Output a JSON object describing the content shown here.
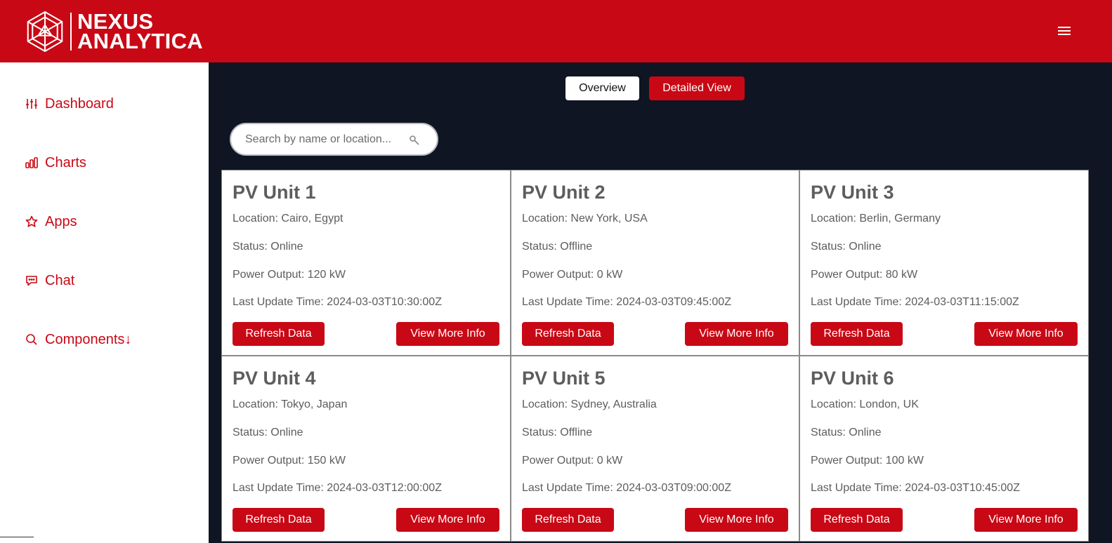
{
  "brand": {
    "line1": "NEXUS",
    "line2": "ANALYTICA",
    "color": "#c90815"
  },
  "header": {
    "menu_icon": "hamburger-menu-icon"
  },
  "sidebar": {
    "items": [
      {
        "label": "Dashboard",
        "icon": "sliders-icon"
      },
      {
        "label": "Charts",
        "icon": "bar-chart-icon"
      },
      {
        "label": "Apps",
        "icon": "star-icon"
      },
      {
        "label": "Chat",
        "icon": "chat-bubble-icon"
      },
      {
        "label": "Components↓",
        "icon": "search-icon"
      }
    ]
  },
  "tabs": {
    "overview": "Overview",
    "detailed": "Detailed View"
  },
  "search": {
    "placeholder": "Search by name or location..."
  },
  "units": [
    {
      "name": "PV Unit 1",
      "location": "Location: Cairo, Egypt",
      "status": "Status: Online",
      "power": "Power Output: 120 kW",
      "updated": "Last Update Time: 2024-03-03T10:30:00Z",
      "refresh": "Refresh Data",
      "more": "View More Info"
    },
    {
      "name": "PV Unit 2",
      "location": "Location: New York, USA",
      "status": "Status: Offline",
      "power": "Power Output: 0 kW",
      "updated": "Last Update Time: 2024-03-03T09:45:00Z",
      "refresh": "Refresh Data",
      "more": "View More Info"
    },
    {
      "name": "PV Unit 3",
      "location": "Location: Berlin, Germany",
      "status": "Status: Online",
      "power": "Power Output: 80 kW",
      "updated": "Last Update Time: 2024-03-03T11:15:00Z",
      "refresh": "Refresh Data",
      "more": "View More Info"
    },
    {
      "name": "PV Unit 4",
      "location": "Location: Tokyo, Japan",
      "status": "Status: Online",
      "power": "Power Output: 150 kW",
      "updated": "Last Update Time: 2024-03-03T12:00:00Z",
      "refresh": "Refresh Data",
      "more": "View More Info"
    },
    {
      "name": "PV Unit 5",
      "location": "Location: Sydney, Australia",
      "status": "Status: Offline",
      "power": "Power Output: 0 kW",
      "updated": "Last Update Time: 2024-03-03T09:00:00Z",
      "refresh": "Refresh Data",
      "more": "View More Info"
    },
    {
      "name": "PV Unit 6",
      "location": "Location: London, UK",
      "status": "Status: Online",
      "power": "Power Output: 100 kW",
      "updated": "Last Update Time: 2024-03-03T10:45:00Z",
      "refresh": "Refresh Data",
      "more": "View More Info"
    }
  ]
}
